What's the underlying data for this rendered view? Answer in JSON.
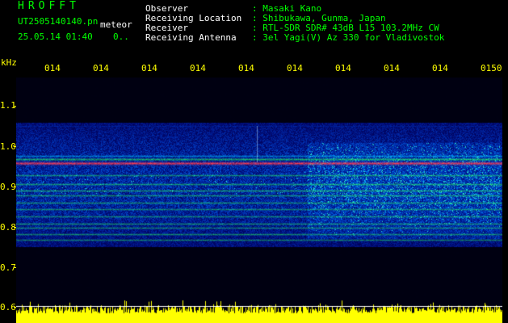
{
  "header": {
    "app_title": "HROFFT",
    "filename": "UT2505140140.pn",
    "tag": "meteor",
    "datetime": "25.05.14 01:40",
    "extra": "0.."
  },
  "info": [
    {
      "label": "Observer",
      "value": ": Masaki Kano"
    },
    {
      "label": "Receiving Location",
      "value": ": Shibukawa, Gunma, Japan"
    },
    {
      "label": "Receiver",
      "value": ": RTL-SDR SDR# 43dB L15 103.2MHz CW"
    },
    {
      "label": "Receiving Antenna",
      "value": ": 3el Yagi(V) Az 330 for Vladivostok"
    }
  ],
  "axis": {
    "y_unit": "kHz",
    "y_ticks": [
      "1.1",
      "1.0",
      "0.9",
      "0.8",
      "0.7",
      "0.6"
    ],
    "x_ticks": [
      "014",
      "014",
      "014",
      "014",
      "014",
      "014",
      "014",
      "014",
      "014",
      "0150"
    ]
  },
  "colors": {
    "header_green": "#00ff00",
    "info_white": "#ffffff",
    "axis_yellow": "#ffff00",
    "spectrogram_background": "#000033",
    "noise_blue": "#0033cc",
    "signal_cyan": "#00ccff",
    "signal_green": "#33ff66",
    "carrier_red": "#ff3333"
  }
}
